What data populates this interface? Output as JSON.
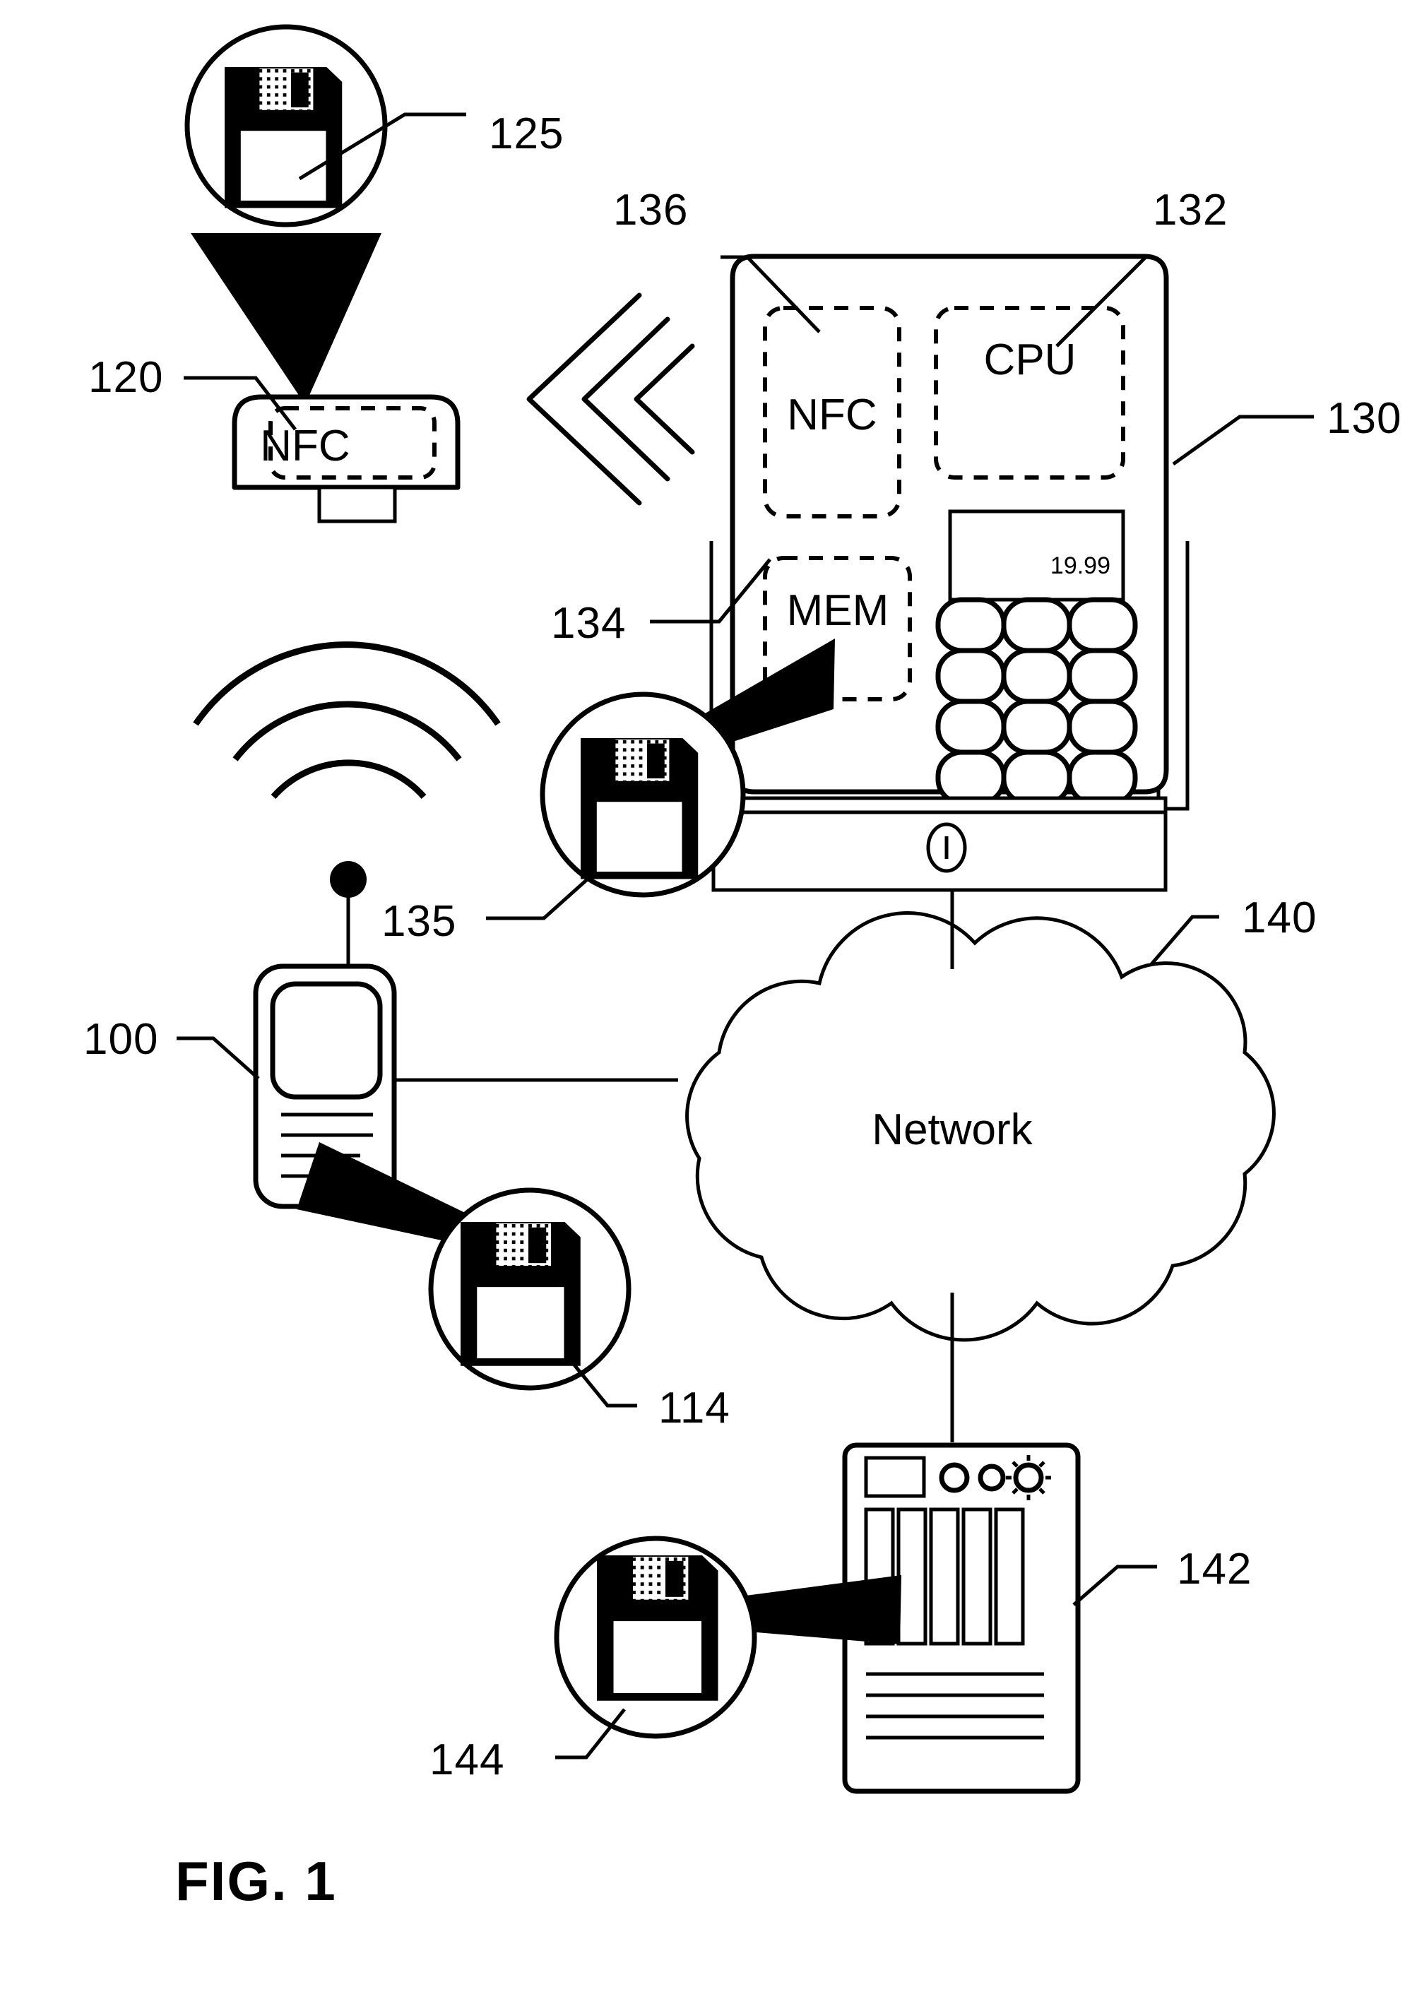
{
  "figure": {
    "caption": "FIG. 1",
    "domain": "patent-diagram"
  },
  "reference_numerals": {
    "n125": "125",
    "n120": "120",
    "n136": "136",
    "n132": "132",
    "n130": "130",
    "n134": "134",
    "n135": "135",
    "n140": "140",
    "n100": "100",
    "n114": "114",
    "n142": "142",
    "n144": "144"
  },
  "nfc_reader": {
    "label": "NFC"
  },
  "pos_terminal": {
    "nfc_label": "NFC",
    "cpu_label": "CPU",
    "mem_label": "MEM",
    "display_value": "19.99",
    "keypad_rows": 4,
    "keypad_cols": 3
  },
  "network": {
    "label": "Network"
  },
  "server": {
    "drive_bays": 5,
    "indicator_count": 3,
    "base_lines": 4
  },
  "mobile_device": {
    "keypad_lines": 4
  },
  "icons": {
    "floppy_disk": "floppy-disk-icon",
    "chevron_left": "chevron-left-icon",
    "radio_wave": "radio-wave-icon",
    "power_button": "power-button-icon",
    "antenna": "antenna-icon",
    "server_indicator": "server-indicator-icon",
    "server_sun_indicator": "server-sun-indicator-icon"
  },
  "colors": {
    "ink": "#000000",
    "paper": "#ffffff"
  }
}
